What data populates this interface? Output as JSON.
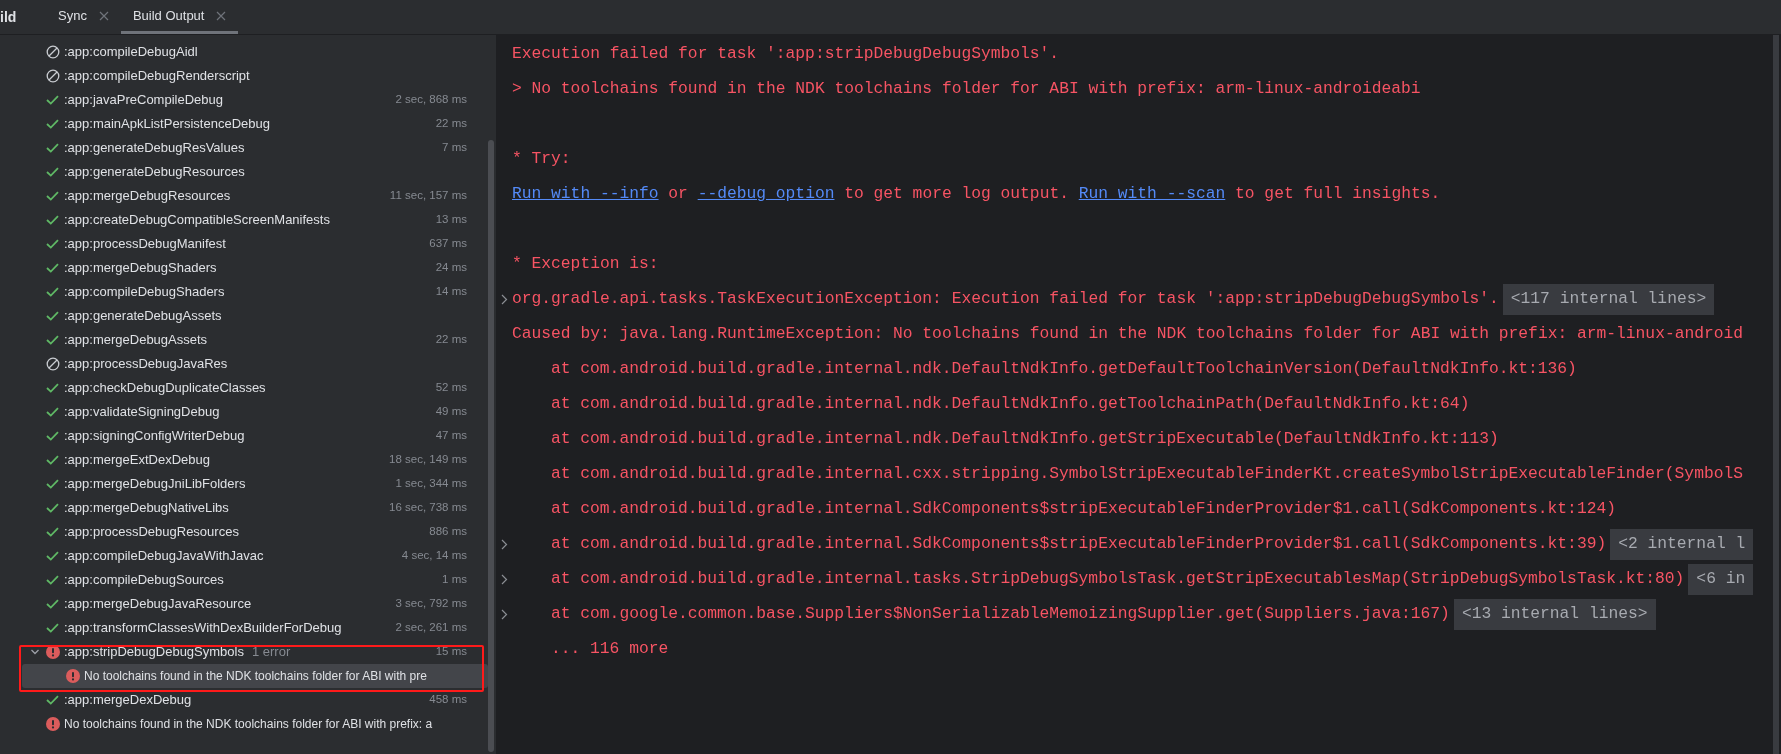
{
  "tool_window": {
    "title": "ild"
  },
  "tabs": [
    {
      "label": "Sync",
      "selected": false
    },
    {
      "label": "Build Output",
      "selected": true
    }
  ],
  "build_tree": {
    "items": [
      {
        "label": ":app:compileDebugAidl",
        "kind": "skipped",
        "selected": false
      },
      {
        "label": ":app:compileDebugRenderscript",
        "kind": "skipped",
        "selected": false
      },
      {
        "label": ":app:javaPreCompileDebug",
        "kind": "success",
        "duration": "2 sec, 868 ms",
        "selected": false
      },
      {
        "label": ":app:mainApkListPersistenceDebug",
        "kind": "success",
        "duration": "22 ms",
        "selected": false
      },
      {
        "label": ":app:generateDebugResValues",
        "kind": "success",
        "duration": "7 ms",
        "selected": false
      },
      {
        "label": ":app:generateDebugResources",
        "kind": "success",
        "selected": false
      },
      {
        "label": ":app:mergeDebugResources",
        "kind": "success",
        "duration": "11 sec, 157 ms",
        "selected": false
      },
      {
        "label": ":app:createDebugCompatibleScreenManifests",
        "kind": "success",
        "duration": "13 ms",
        "selected": false
      },
      {
        "label": ":app:processDebugManifest",
        "kind": "success",
        "duration": "637 ms",
        "selected": false
      },
      {
        "label": ":app:mergeDebugShaders",
        "kind": "success",
        "duration": "24 ms",
        "selected": false
      },
      {
        "label": ":app:compileDebugShaders",
        "kind": "success",
        "duration": "14 ms",
        "selected": false
      },
      {
        "label": ":app:generateDebugAssets",
        "kind": "success",
        "selected": false
      },
      {
        "label": ":app:mergeDebugAssets",
        "kind": "success",
        "duration": "22 ms",
        "selected": false
      },
      {
        "label": ":app:processDebugJavaRes",
        "kind": "skipped",
        "selected": false
      },
      {
        "label": ":app:checkDebugDuplicateClasses",
        "kind": "success",
        "duration": "52 ms",
        "selected": false
      },
      {
        "label": ":app:validateSigningDebug",
        "kind": "success",
        "duration": "49 ms",
        "selected": false
      },
      {
        "label": ":app:signingConfigWriterDebug",
        "kind": "success",
        "duration": "47 ms",
        "selected": false
      },
      {
        "label": ":app:mergeExtDexDebug",
        "kind": "success",
        "duration": "18 sec, 149 ms",
        "selected": false
      },
      {
        "label": ":app:mergeDebugJniLibFolders",
        "kind": "success",
        "duration": "1 sec, 344 ms",
        "selected": false
      },
      {
        "label": ":app:mergeDebugNativeLibs",
        "kind": "success",
        "duration": "16 sec, 738 ms",
        "selected": false
      },
      {
        "label": ":app:processDebugResources",
        "kind": "success",
        "duration": "886 ms",
        "selected": false
      },
      {
        "label": ":app:compileDebugJavaWithJavac",
        "kind": "success",
        "duration": "4 sec, 14 ms",
        "selected": false
      },
      {
        "label": ":app:compileDebugSources",
        "kind": "success",
        "duration": "1 ms",
        "selected": false
      },
      {
        "label": ":app:mergeDebugJavaResource",
        "kind": "success",
        "duration": "3 sec, 792 ms",
        "selected": false
      },
      {
        "label": ":app:transformClassesWithDexBuilderForDebug",
        "kind": "success",
        "duration": "2 sec, 261 ms",
        "selected": false
      },
      {
        "label": ":app:stripDebugDebugSymbols",
        "kind": "error",
        "note": "1 error",
        "duration": "15 ms",
        "expanded": true,
        "selected": false,
        "children": [
          {
            "label": "No toolchains found in the NDK toolchains folder for ABI with pre",
            "kind": "error",
            "selected": true
          }
        ]
      },
      {
        "label": ":app:mergeDexDebug",
        "kind": "success",
        "duration": "458 ms",
        "selected": false
      },
      {
        "label": "No toolchains found in the NDK toolchains folder for ABI with prefix: a",
        "kind": "error",
        "selected": false
      }
    ]
  },
  "console": {
    "lines": [
      {
        "kind": "text",
        "segments": [
          {
            "kind": "plain",
            "text": "Execution failed for task ':app:stripDebugDebugSymbols'."
          }
        ]
      },
      {
        "kind": "text",
        "segments": [
          {
            "kind": "plain",
            "text": "> No toolchains found in the NDK toolchains folder for ABI with prefix: arm-linux-androideabi"
          }
        ]
      },
      {
        "kind": "blank"
      },
      {
        "kind": "text",
        "segments": [
          {
            "kind": "plain",
            "text": "* Try:"
          }
        ]
      },
      {
        "kind": "text",
        "segments": [
          {
            "kind": "link",
            "text": "Run with --info"
          },
          {
            "kind": "plain",
            "text": " or "
          },
          {
            "kind": "link",
            "text": "--debug option"
          },
          {
            "kind": "plain",
            "text": " to get more log output. "
          },
          {
            "kind": "link",
            "text": "Run with --scan"
          },
          {
            "kind": "plain",
            "text": " to get full insights."
          }
        ]
      },
      {
        "kind": "blank"
      },
      {
        "kind": "text",
        "segments": [
          {
            "kind": "plain",
            "text": "* Exception is:"
          }
        ]
      },
      {
        "kind": "text",
        "expandable": true,
        "segments": [
          {
            "kind": "plain",
            "text": "org.gradle.api.tasks.TaskExecutionException: Execution failed for task ':app:stripDebugDebugSymbols'."
          }
        ],
        "badge": "<117 internal lines>"
      },
      {
        "kind": "text",
        "segments": [
          {
            "kind": "plain",
            "text": "Caused by: java.lang.RuntimeException: No toolchains found in the NDK toolchains folder for ABI with prefix: arm-linux-android"
          }
        ]
      },
      {
        "kind": "text",
        "indented": true,
        "segments": [
          {
            "kind": "plain",
            "text": "at com.android.build.gradle.internal.ndk.DefaultNdkInfo.getDefaultToolchainVersion(DefaultNdkInfo.kt:136)"
          }
        ]
      },
      {
        "kind": "text",
        "indented": true,
        "segments": [
          {
            "kind": "plain",
            "text": "at com.android.build.gradle.internal.ndk.DefaultNdkInfo.getToolchainPath(DefaultNdkInfo.kt:64)"
          }
        ]
      },
      {
        "kind": "text",
        "indented": true,
        "segments": [
          {
            "kind": "plain",
            "text": "at com.android.build.gradle.internal.ndk.DefaultNdkInfo.getStripExecutable(DefaultNdkInfo.kt:113)"
          }
        ]
      },
      {
        "kind": "text",
        "indented": true,
        "segments": [
          {
            "kind": "plain",
            "text": "at com.android.build.gradle.internal.cxx.stripping.SymbolStripExecutableFinderKt.createSymbolStripExecutableFinder(SymbolS"
          }
        ]
      },
      {
        "kind": "text",
        "indented": true,
        "segments": [
          {
            "kind": "plain",
            "text": "at com.android.build.gradle.internal.SdkComponents$stripExecutableFinderProvider$1.call(SdkComponents.kt:124)"
          }
        ]
      },
      {
        "kind": "text",
        "indented": true,
        "expandable": true,
        "segments": [
          {
            "kind": "plain",
            "text": "at com.android.build.gradle.internal.SdkComponents$stripExecutableFinderProvider$1.call(SdkComponents.kt:39)"
          }
        ],
        "badge": "<2 internal l"
      },
      {
        "kind": "text",
        "indented": true,
        "expandable": true,
        "segments": [
          {
            "kind": "plain",
            "text": "at com.android.build.gradle.internal.tasks.StripDebugSymbolsTask.getStripExecutablesMap(StripDebugSymbolsTask.kt:80)"
          }
        ],
        "badge": "<6 in"
      },
      {
        "kind": "text",
        "indented": true,
        "expandable": true,
        "segments": [
          {
            "kind": "plain",
            "text": "at com.google.common.base.Suppliers$NonSerializableMemoizingSupplier.get(Suppliers.java:167)"
          }
        ],
        "badge": "<13 internal lines>"
      },
      {
        "kind": "text",
        "indented": true,
        "segments": [
          {
            "kind": "plain",
            "text": "... 116 more"
          }
        ]
      }
    ]
  }
}
